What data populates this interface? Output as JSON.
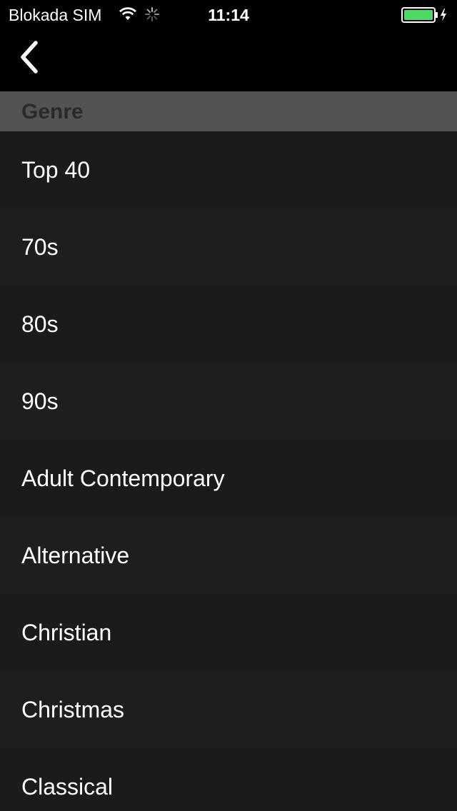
{
  "status_bar": {
    "carrier": "Blokada SIM",
    "time": "11:14",
    "battery_color": "#4cd964"
  },
  "nav": {
    "back_icon": "chevron-left-icon"
  },
  "section": {
    "title": "Genre"
  },
  "genres": [
    {
      "label": "Top 40"
    },
    {
      "label": "70s"
    },
    {
      "label": "80s"
    },
    {
      "label": "90s"
    },
    {
      "label": "Adult Contemporary"
    },
    {
      "label": "Alternative"
    },
    {
      "label": "Christian"
    },
    {
      "label": "Christmas"
    },
    {
      "label": "Classical"
    }
  ]
}
